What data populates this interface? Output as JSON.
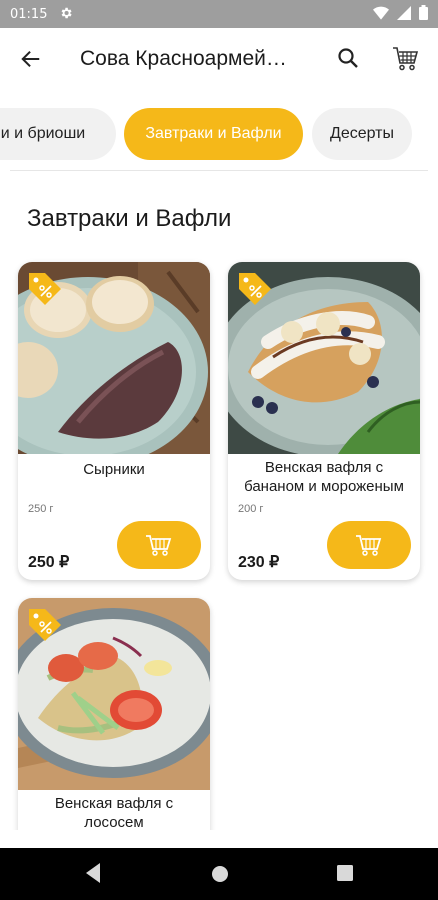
{
  "status_bar": {
    "time": "01:15",
    "icons": [
      "gear-icon",
      "wifi-icon",
      "signal-icon",
      "battery-icon"
    ]
  },
  "app_bar": {
    "title": "Сова Красноармейская",
    "back_icon": "arrow-left-icon",
    "search_icon": "search-icon",
    "cart_icon": "cart-icon"
  },
  "categories": [
    {
      "label": "и и бриоши",
      "active": false
    },
    {
      "label": "Завтраки и Вафли",
      "active": true
    },
    {
      "label": "Десерты",
      "active": false
    }
  ],
  "section": {
    "title": "Завтраки и Вафли"
  },
  "products": [
    {
      "name": "Сырники",
      "weight": "250 г",
      "price": "250 ₽",
      "badge_icon": "discount-tag-icon"
    },
    {
      "name": "Венская вафля с бананом и мороженым",
      "weight": "200 г",
      "price": "230 ₽",
      "badge_icon": "discount-tag-icon"
    },
    {
      "name": "Венская вафля с лососем",
      "badge_icon": "discount-tag-icon"
    }
  ],
  "colors": {
    "accent": "#f5b819",
    "status_bar": "#9e9e9e",
    "nav_bar": "#000000",
    "chip_bg": "#f1f1f1"
  },
  "nav_bar": {
    "icons": [
      "back-triangle-icon",
      "home-circle-icon",
      "recents-square-icon"
    ]
  }
}
